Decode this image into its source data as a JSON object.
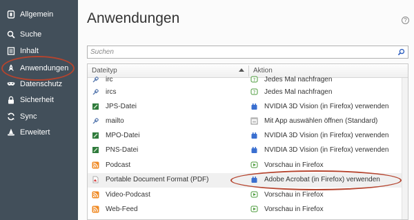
{
  "sidebar": {
    "items": [
      {
        "label": "Allgemein",
        "icon": "general-icon"
      },
      {
        "label": "Suche",
        "icon": "search-icon"
      },
      {
        "label": "Inhalt",
        "icon": "content-icon"
      },
      {
        "label": "Anwendungen",
        "icon": "rocket-icon",
        "selected": true
      },
      {
        "label": "Datenschutz",
        "icon": "mask-icon"
      },
      {
        "label": "Sicherheit",
        "icon": "lock-icon"
      },
      {
        "label": "Sync",
        "icon": "sync-icon"
      },
      {
        "label": "Erweitert",
        "icon": "wizard-hat-icon"
      }
    ]
  },
  "main": {
    "title": "Anwendungen",
    "help": "?",
    "search": {
      "placeholder": "Suchen",
      "value": ""
    },
    "table": {
      "columns": [
        "Dateityp",
        "Aktion"
      ],
      "rows": [
        {
          "type": "irc",
          "type_icon": "link-icon",
          "action": "Jedes Mal nachfragen",
          "action_icon": "ask-icon"
        },
        {
          "type": "ircs",
          "type_icon": "link-icon",
          "action": "Jedes Mal nachfragen",
          "action_icon": "ask-icon"
        },
        {
          "type": "JPS-Datei",
          "type_icon": "stereo-file-icon",
          "action": "NVIDIA 3D Vision (in Firefox) verwenden",
          "action_icon": "plugin-icon"
        },
        {
          "type": "mailto",
          "type_icon": "link-icon",
          "action": "Mit App auswählen öffnen (Standard)",
          "action_icon": "app-chooser-icon"
        },
        {
          "type": "MPO-Datei",
          "type_icon": "stereo-file-icon",
          "action": "NVIDIA 3D Vision (in Firefox) verwenden",
          "action_icon": "plugin-icon"
        },
        {
          "type": "PNS-Datei",
          "type_icon": "stereo-file-icon",
          "action": "NVIDIA 3D Vision (in Firefox) verwenden",
          "action_icon": "plugin-icon"
        },
        {
          "type": "Podcast",
          "type_icon": "feed-icon",
          "action": "Vorschau in Firefox",
          "action_icon": "preview-icon"
        },
        {
          "type": "Portable Document Format (PDF)",
          "type_icon": "pdf-icon",
          "action": "Adobe Acrobat (in Firefox) verwenden",
          "action_icon": "plugin-icon",
          "selected": true
        },
        {
          "type": "Video-Podcast",
          "type_icon": "feed-icon",
          "action": "Vorschau in Firefox",
          "action_icon": "preview-icon"
        },
        {
          "type": "Web-Feed",
          "type_icon": "feed-icon",
          "action": "Vorschau in Firefox",
          "action_icon": "preview-icon"
        }
      ]
    }
  },
  "colors": {
    "sidebar_bg": "#424f5a",
    "highlight": "#b5442e",
    "feed": "#f08a24",
    "plugin": "#3a6fd0",
    "preview": "#4a9a3a"
  }
}
